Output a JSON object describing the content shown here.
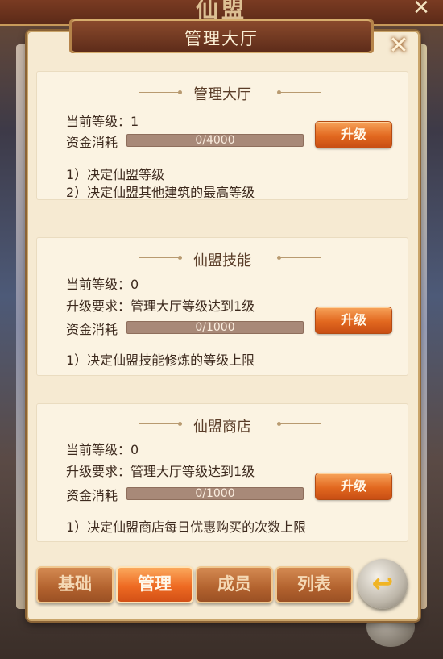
{
  "outer": {
    "title": "仙盟"
  },
  "dialog": {
    "title": "管理大厅",
    "close_icon": "close-icon"
  },
  "sections": [
    {
      "title": "管理大厅",
      "level_label": "当前等级：1",
      "cost_label": "资金消耗",
      "cost_text": "0/4000",
      "progress": 0,
      "button_label": "升级",
      "desc": [
        "1）决定仙盟等级",
        "2）决定仙盟其他建筑的最高等级"
      ]
    },
    {
      "title": "仙盟技能",
      "level_label": "当前等级：0",
      "requirement": "升级要求：管理大厅等级达到1级",
      "cost_label": "资金消耗",
      "cost_text": "0/1000",
      "progress": 0,
      "button_label": "升级",
      "desc": [
        "1）决定仙盟技能修炼的等级上限"
      ]
    },
    {
      "title": "仙盟商店",
      "level_label": "当前等级：0",
      "requirement": "升级要求：管理大厅等级达到1级",
      "cost_label": "资金消耗",
      "cost_text": "0/1000",
      "progress": 0,
      "button_label": "升级",
      "desc": [
        "1）决定仙盟商店每日优惠购买的次数上限"
      ]
    }
  ],
  "tabs": [
    {
      "label": "基础",
      "active": false
    },
    {
      "label": "管理",
      "active": true
    },
    {
      "label": "成员",
      "active": false
    },
    {
      "label": "列表",
      "active": false
    }
  ],
  "back_icon": "return-arrow-icon",
  "colors": {
    "accent": "#e2681f",
    "panel": "#f6ead2",
    "bar": "#a88978"
  }
}
